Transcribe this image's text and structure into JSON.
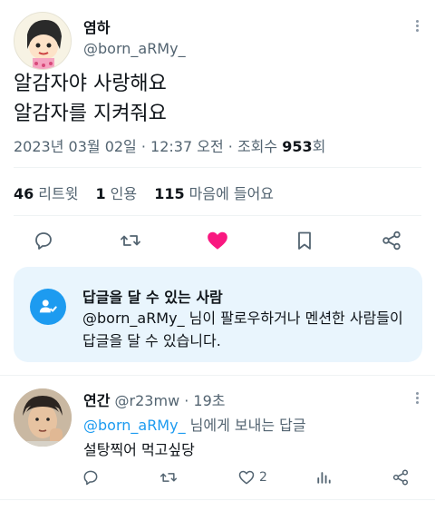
{
  "tweet": {
    "author_name": "염하",
    "author_handle": "@born_aRMy_",
    "text_line1": "알감자야 사랑해요",
    "text_line2": "알감자를 지켜줘요",
    "date": "2023년 03월 02일",
    "time": "12:37 오전",
    "views_label": "조회수",
    "views_count": "953",
    "views_suffix": "회",
    "retweets_count": "46",
    "retweets_label": "리트윗",
    "quotes_count": "1",
    "quotes_label": "인용",
    "likes_count": "115",
    "likes_label": "마음에 들어요",
    "liked": true
  },
  "reply_restriction": {
    "title": "답글을 달 수 있는 사람",
    "description": "@born_aRMy_ 님이 팔로우하거나 멘션한 사람들이 답글을 달 수 있습니다."
  },
  "reply": {
    "author_name": "연간",
    "author_handle": "@r23mw",
    "time": "19초",
    "mention": "@born_aRMy_",
    "reply_to_suffix": "님에게 보내는 답글",
    "text": "설탕찍어 먹고싶당",
    "likes_count": "2"
  },
  "colors": {
    "accent": "#1d9bf0",
    "like": "#f91880",
    "secondary_text": "#536471",
    "restriction_bg": "#e9f5fd"
  },
  "icons": [
    "more-icon",
    "reply-icon",
    "retweet-icon",
    "like-icon",
    "bookmark-icon",
    "share-icon",
    "users-icon",
    "views-icon"
  ]
}
